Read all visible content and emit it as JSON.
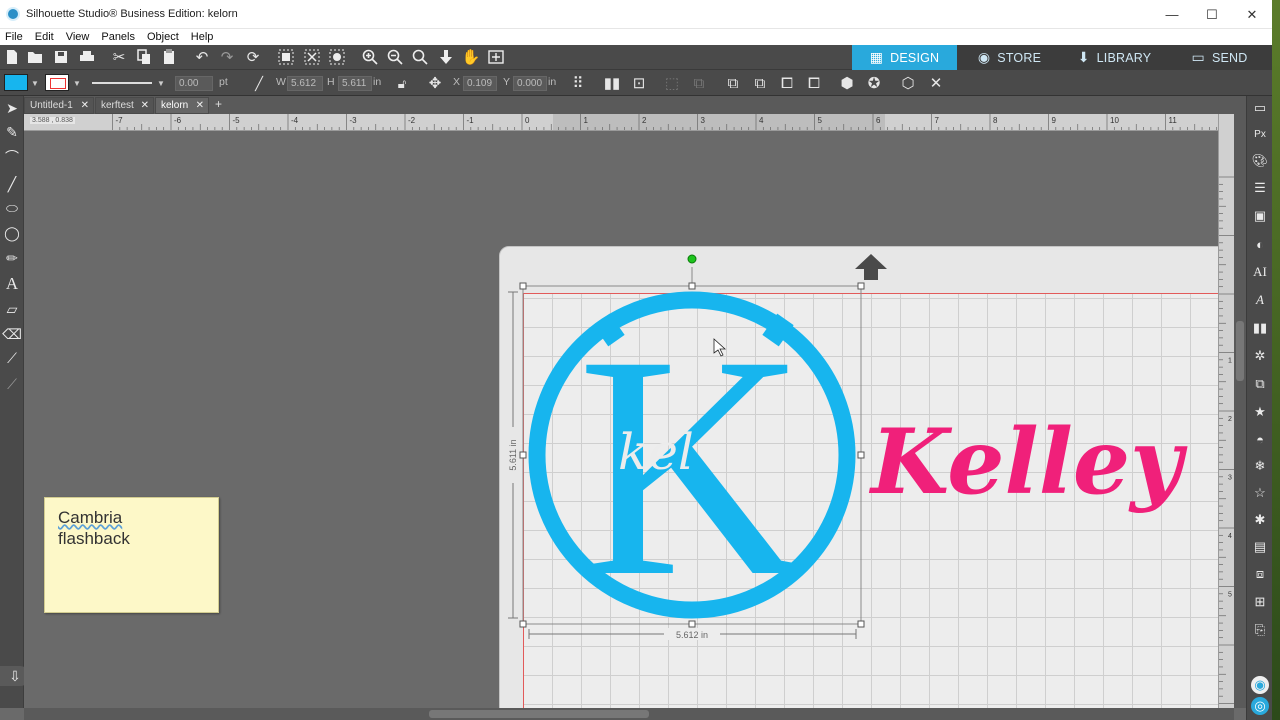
{
  "window": {
    "title": "Silhouette Studio® Business Edition: kelorn",
    "controls": [
      "—",
      "☐",
      "✕"
    ]
  },
  "menu": [
    "File",
    "Edit",
    "View",
    "Panels",
    "Object",
    "Help"
  ],
  "top_tabs": [
    {
      "label": "DESIGN",
      "icon": "grid-icon",
      "active": true
    },
    {
      "label": "STORE",
      "icon": "store-icon",
      "active": false
    },
    {
      "label": "LIBRARY",
      "icon": "library-icon",
      "active": false
    },
    {
      "label": "SEND",
      "icon": "send-icon",
      "active": false
    }
  ],
  "properties": {
    "fill_color": "#17b5ee",
    "line_width": "0.00",
    "line_unit": "pt",
    "w_label": "W",
    "w_value": "5.612",
    "h_label": "H",
    "h_value": "5.611",
    "size_unit": "in",
    "x_label": "X",
    "x_value": "0.109",
    "y_label": "Y",
    "y_value": "0.000",
    "pos_unit": "in"
  },
  "doc_tabs": [
    {
      "label": "Untitled-1",
      "active": false
    },
    {
      "label": "kerftest",
      "active": false
    },
    {
      "label": "kelorn",
      "active": true
    }
  ],
  "add_tab": "+",
  "ruler": {
    "cursor_coords": "3.588 , 0.838",
    "h_labels": [
      "-7",
      "-6",
      "-5",
      "-4",
      "-3",
      "-2",
      "-1",
      "0",
      "1",
      "2",
      "3",
      "4",
      "5",
      "6",
      "7",
      "8",
      "9",
      "10",
      "11"
    ],
    "v_labels": [
      "1",
      "2",
      "3",
      "4",
      "5"
    ]
  },
  "sticky_note": {
    "line1": "Cambria",
    "line2": "flashback"
  },
  "design": {
    "name_text": "Kelley",
    "monogram_letter": "K",
    "inner_script": "kel",
    "width_dim": "5.612 in",
    "height_dim": "5.611 in",
    "monogram_color": "#17b5ee",
    "name_color": "#f0207a"
  },
  "colors": {
    "accent": "#29a9dc",
    "toolbar_bg": "#4a4a4a",
    "canvas_bg": "#6a6a6a",
    "mat_border": "#e25a5a"
  }
}
